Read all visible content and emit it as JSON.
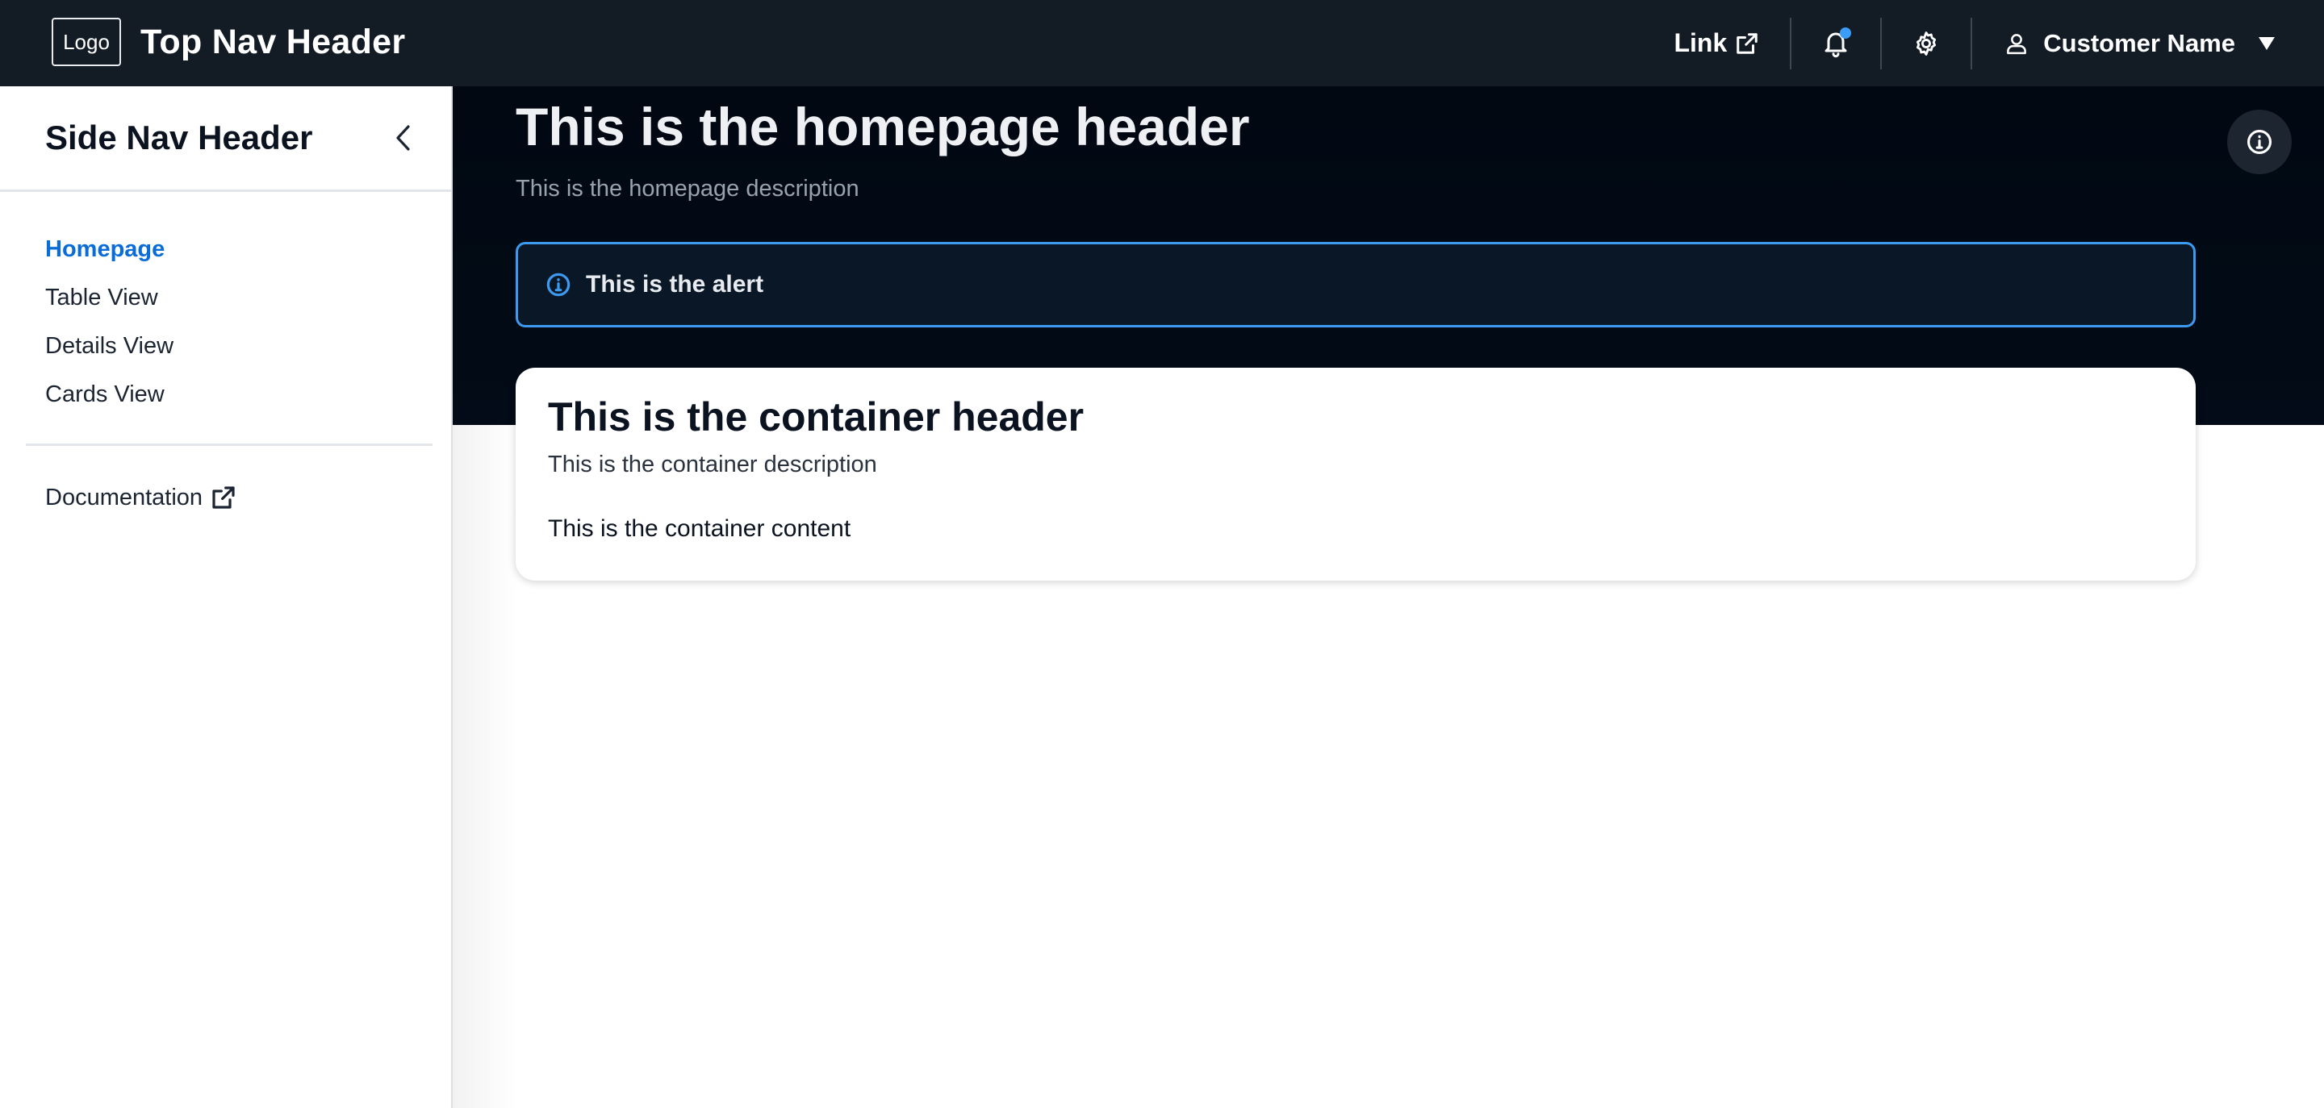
{
  "topnav": {
    "logo": "Logo",
    "title": "Top Nav Header",
    "link_label": "Link",
    "link_icon": "external-link-icon",
    "notification_icon": "bell-icon",
    "settings_icon": "gear-icon",
    "user_icon": "user-icon",
    "user_name": "Customer Name",
    "user_caret_icon": "caret-down-icon"
  },
  "sidenav": {
    "header": "Side Nav Header",
    "collapse_icon": "chevron-left-icon",
    "items": [
      {
        "label": "Homepage",
        "active": true
      },
      {
        "label": "Table View",
        "active": false
      },
      {
        "label": "Details View",
        "active": false
      },
      {
        "label": "Cards View",
        "active": false
      }
    ],
    "documentation": {
      "label": "Documentation",
      "icon": "external-link-icon"
    }
  },
  "page": {
    "title": "This is the homepage header",
    "description": "This is the homepage description",
    "info_icon": "info-icon"
  },
  "alert": {
    "text": "This is the alert",
    "icon": "info-icon"
  },
  "container": {
    "header": "This is the container header",
    "description": "This is the container description",
    "content": "This is the container content"
  },
  "colors": {
    "topnav_bg": "#131b25",
    "hero_bg": "#020b17",
    "accent": "#0a6cd6",
    "alert_border": "#3d9af0",
    "notification_dot": "#3b9df8"
  }
}
